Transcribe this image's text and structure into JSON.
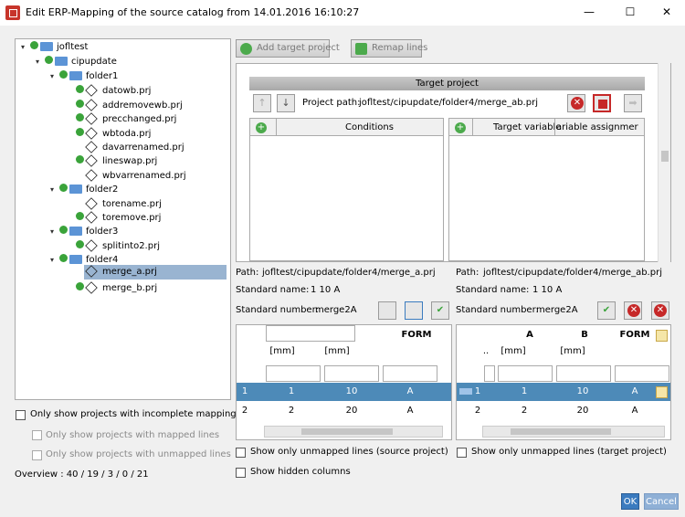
{
  "window": {
    "title": "Edit ERP-Mapping of the source catalog from 14.01.2016 16:10:27",
    "minimize": "—",
    "maximize": "☐",
    "close": "✕"
  },
  "tree": {
    "nodes": [
      {
        "label": "jofltest",
        "type": "folder"
      },
      {
        "label": "cipupdate",
        "type": "folder"
      },
      {
        "label": "folder1",
        "type": "folder"
      },
      {
        "label": "datowb.prj",
        "type": "project"
      },
      {
        "label": "addremovewb.prj",
        "type": "project"
      },
      {
        "label": "precchanged.prj",
        "type": "project"
      },
      {
        "label": "wbtoda.prj",
        "type": "project"
      },
      {
        "label": "davarrenamed.prj",
        "type": "project"
      },
      {
        "label": "lineswap.prj",
        "type": "project"
      },
      {
        "label": "wbvarrenamed.prj",
        "type": "project"
      },
      {
        "label": "folder2",
        "type": "folder"
      },
      {
        "label": "torename.prj",
        "type": "project"
      },
      {
        "label": "toremove.prj",
        "type": "project"
      },
      {
        "label": "folder3",
        "type": "folder"
      },
      {
        "label": "splitinto2.prj",
        "type": "project"
      },
      {
        "label": "folder4",
        "type": "folder"
      },
      {
        "label": "merge_a.prj",
        "type": "project"
      },
      {
        "label": "merge_b.prj",
        "type": "project"
      }
    ]
  },
  "filters": {
    "incomplete": "Only show projects with incomplete mappings",
    "mapped": "Only show projects with mapped lines",
    "unmapped": "Only show projects with unmapped lines",
    "overview": "Overview : 40 / 19 / 3 / 0 / 21"
  },
  "toolbar": {
    "add_target": "Add target project",
    "remap": "Remap lines"
  },
  "target": {
    "header": "Target project",
    "path_label": "Project path:",
    "path_value": "jofltest/cipupdate/folder4/merge_ab.prj",
    "conditions_header": "Conditions",
    "target_var_header": "Target variable",
    "var_assign_header": "ariable assignmer"
  },
  "left_info": {
    "path_label": "Path:",
    "path_value": "jofltest/cipupdate/folder4/merge_a.prj",
    "stdname_label": "Standard name:",
    "stdname_value": "1 10 A",
    "stdnum_label": "Standard number:",
    "stdnum_value": "merge2A"
  },
  "right_info": {
    "path_label": "Path:",
    "path_value": "jofltest/cipupdate/folder4/merge_ab.prj",
    "stdname_label": "Standard name:",
    "stdname_value": "1 10 A",
    "stdnum_label": "Standard number:",
    "stdnum_value": "merge2A"
  },
  "left_table": {
    "col3": "FORM",
    "unit1": "[mm]",
    "unit2": "[mm]",
    "rows": [
      [
        "1",
        "1",
        "10",
        "A"
      ],
      [
        "2",
        "2",
        "20",
        "A"
      ]
    ]
  },
  "right_table": {
    "colA": "A",
    "colB": "B",
    "colForm": "FORM",
    "dots": "..",
    "unit1": "[mm]",
    "unit2": "[mm]",
    "rows": [
      [
        "1",
        "1",
        "10",
        "A"
      ],
      [
        "2",
        "2",
        "20",
        "A"
      ]
    ]
  },
  "options": {
    "unmapped_source": "Show only unmapped lines (source project)",
    "unmapped_target": "Show only unmapped lines (target project)",
    "hidden_cols": "Show hidden columns"
  },
  "footer": {
    "ok": "OK",
    "cancel": "Cancel"
  },
  "colors": {
    "accent": "#3b7bbf",
    "selection": "#4d8ab8",
    "tree_selection": "#99b4d1"
  }
}
